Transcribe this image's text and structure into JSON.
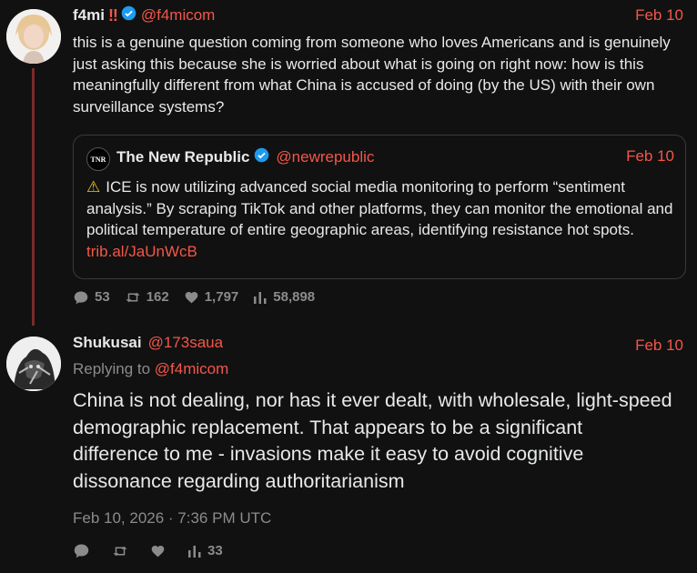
{
  "post1": {
    "name": "f4mi",
    "badge": "‼",
    "handle": "@f4micom",
    "date": "Feb 10",
    "text": "this is a genuine question coming from someone who loves Americans and is genuinely just asking this because she is worried about what is going on right now: how is this meaningfully different from what China is accused of doing (by the US) with their own surveillance systems?",
    "quote": {
      "logo": "TNR",
      "name": "The New Republic",
      "handle": "@newrepublic",
      "date": "Feb 10",
      "warning": "⚠",
      "text": "ICE is now utilizing advanced social media monitoring to perform “sentiment analysis.” By scraping TikTok and other platforms, they can monitor the emotional and political temperature of entire geographic areas, identifying resistance hot spots.",
      "link": "trib.al/JaUnWcB"
    },
    "stats": {
      "replies": "53",
      "reposts": "162",
      "likes": "1,797",
      "views": "58,898"
    }
  },
  "post2": {
    "name": "Shukusai",
    "handle": "@173saua",
    "date": "Feb 10",
    "replying_prefix": "Replying to",
    "replying_to": "@f4micom",
    "text": "China is not dealing, nor has it ever dealt, with wholesale, light-speed demographic replacement. That appears to be a significant difference to me - invasions make it easy to avoid cognitive dissonance regarding authoritarianism",
    "timestamp": "Feb 10, 2026 · 7:36 PM UTC",
    "stats": {
      "views": "33"
    }
  },
  "colors": {
    "accent": "#f4564a",
    "thread_line": "#7a2a2a",
    "muted": "#8b8b8b",
    "verified": "#1d9bf0"
  }
}
